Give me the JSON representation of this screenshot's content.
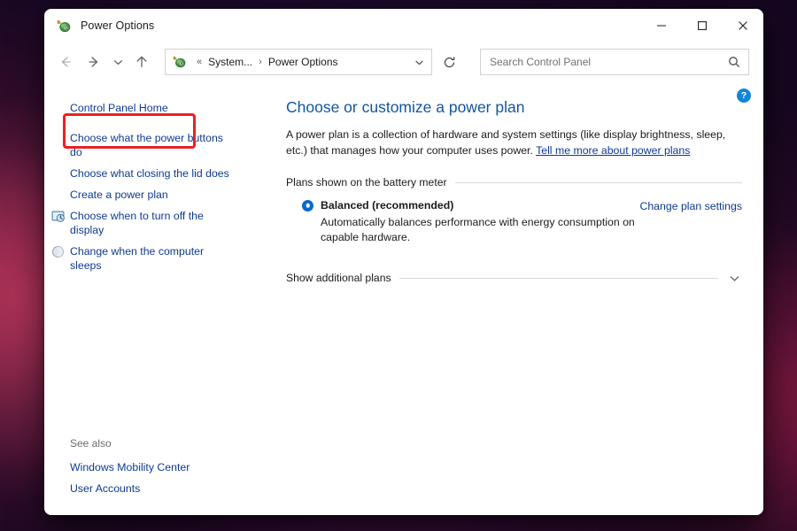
{
  "window": {
    "title": "Power Options",
    "app_icon": "power-plug-icon",
    "controls": {
      "minimize": "Minimize",
      "maximize": "Maximize",
      "close": "Close"
    }
  },
  "toolbar": {
    "back": "Back",
    "forward": "Forward",
    "recent": "Recent locations",
    "up": "Up",
    "refresh": "Refresh",
    "address": {
      "icon": "power-plug-icon",
      "separator_first": "«",
      "crumbs": [
        "System...",
        "Power Options"
      ],
      "separator": "›",
      "dropdown": "chevron-down-icon"
    },
    "search": {
      "placeholder": "Search Control Panel",
      "value": "",
      "icon": "search-icon"
    }
  },
  "sidebar": {
    "home": "Control Panel Home",
    "items": [
      {
        "label": "Choose what the power buttons do",
        "icon": "",
        "highlighted": true
      },
      {
        "label": "Choose what closing the lid does",
        "icon": ""
      },
      {
        "label": "Create a power plan",
        "icon": ""
      },
      {
        "label": "Choose when to turn off the display",
        "icon": "display-timeout-icon"
      },
      {
        "label": "Change when the computer sleeps",
        "icon": "sleep-moon-icon"
      }
    ],
    "see_also": {
      "title": "See also",
      "links": [
        "Windows Mobility Center",
        "User Accounts"
      ]
    }
  },
  "content": {
    "heading": "Choose or customize a power plan",
    "intro_text": "A power plan is a collection of hardware and system settings (like display brightness, sleep, etc.) that manages how your computer uses power. ",
    "intro_link": "Tell me more about power plans",
    "section_label": "Plans shown on the battery meter",
    "plans": [
      {
        "name": "Balanced (recommended)",
        "description": "Automatically balances performance with energy consumption on capable hardware.",
        "selected": true,
        "action": "Change plan settings"
      }
    ],
    "show_additional": "Show additional plans",
    "help": "?"
  },
  "colors": {
    "link": "#0d3a91",
    "heading": "#12559c",
    "accent": "#0a68c8",
    "highlight": "#ec2024",
    "help_bg": "#1186d6"
  }
}
